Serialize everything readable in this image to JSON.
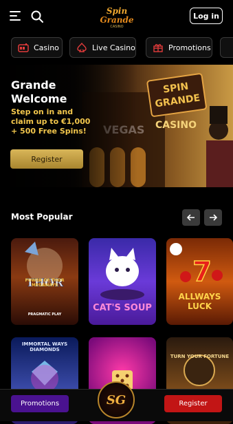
{
  "header": {
    "logo_alt": "Spin Grande Casino",
    "login_label": "Log in"
  },
  "tabs": [
    {
      "label": "Casino",
      "icon": "slot-machine-icon"
    },
    {
      "label": "Live Casino",
      "icon": "spade-icon"
    },
    {
      "label": "Promotions",
      "icon": "gift-icon"
    }
  ],
  "hero": {
    "title": "Grande Welcome",
    "subtitle": "Step on in and claim up to €1,000 + 500 Free Spins!",
    "register_label": "Register",
    "sign_line1": "SPIN",
    "sign_line2": "GRANDE",
    "sign_line3": "CASINO",
    "backdrop_text": "VEGAS"
  },
  "popular": {
    "title": "Most Popular",
    "prev_icon": "arrow-left-icon",
    "next_icon": "arrow-right-icon",
    "games": [
      {
        "name": "POWER OF THOR MEGAWAYS",
        "provider": "PRAGMATIC PLAY"
      },
      {
        "name": "CAT'S SOUP"
      },
      {
        "name": "ALLWAYS LUCK"
      },
      {
        "name": "IMMORTAL WAYS DIAMONDS"
      },
      {
        "name": ""
      },
      {
        "name": "TURN YOUR FORTUNE"
      }
    ]
  },
  "bottom_bar": {
    "promotions_label": "Promotions",
    "register_label": "Register",
    "badge_text": "SG"
  },
  "colors": {
    "gold": "#d9b659",
    "accent_yellow": "#f2c64c",
    "promotions_purple": "#4a1290",
    "register_red": "#c21515"
  }
}
